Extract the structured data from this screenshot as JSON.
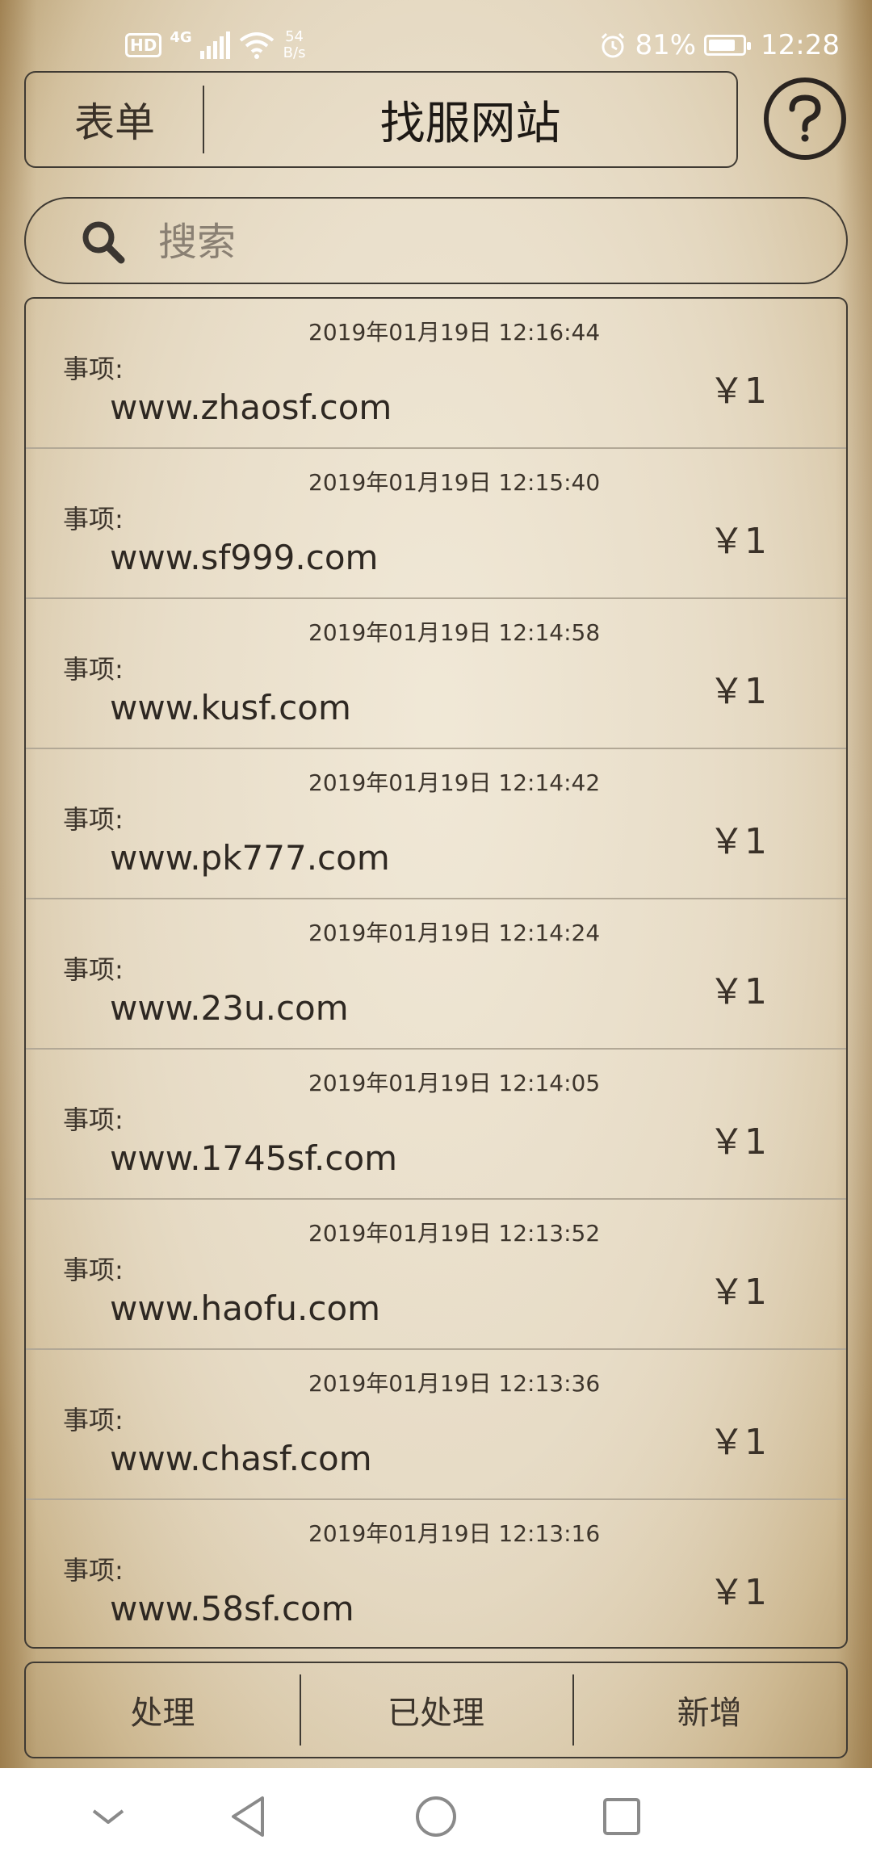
{
  "status_bar": {
    "hd": "HD",
    "network": "4G",
    "speed_value": "54",
    "speed_unit": "B/s",
    "battery_percent": "81%",
    "battery_level": 0.81,
    "time": "12:28"
  },
  "header": {
    "left_label": "表单",
    "title": "找服网站",
    "help_icon": "question-circle-icon"
  },
  "search": {
    "placeholder": "搜索",
    "value": ""
  },
  "list": {
    "items": [
      {
        "time": "2019年01月19日 12:16:44",
        "label": "事项:",
        "value": "www.zhaosf.com",
        "amount": "￥1"
      },
      {
        "time": "2019年01月19日 12:15:40",
        "label": "事项:",
        "value": "www.sf999.com",
        "amount": "￥1"
      },
      {
        "time": "2019年01月19日 12:14:58",
        "label": "事项:",
        "value": "www.kusf.com",
        "amount": "￥1"
      },
      {
        "time": "2019年01月19日 12:14:42",
        "label": "事项:",
        "value": "www.pk777.com",
        "amount": "￥1"
      },
      {
        "time": "2019年01月19日 12:14:24",
        "label": "事项:",
        "value": "www.23u.com",
        "amount": "￥1"
      },
      {
        "time": "2019年01月19日 12:14:05",
        "label": "事项:",
        "value": "www.1745sf.com",
        "amount": "￥1"
      },
      {
        "time": "2019年01月19日 12:13:52",
        "label": "事项:",
        "value": "www.haofu.com",
        "amount": "￥1"
      },
      {
        "time": "2019年01月19日 12:13:36",
        "label": "事项:",
        "value": "www.chasf.com",
        "amount": "￥1"
      },
      {
        "time": "2019年01月19日 12:13:16",
        "label": "事项:",
        "value": "www.58sf.com",
        "amount": "￥1"
      }
    ]
  },
  "tabs": [
    {
      "label": "处理"
    },
    {
      "label": "已处理"
    },
    {
      "label": "新增"
    }
  ],
  "nav_bar": {
    "icons": [
      "chevron-down-icon",
      "back-icon",
      "home-icon",
      "recents-icon"
    ]
  }
}
